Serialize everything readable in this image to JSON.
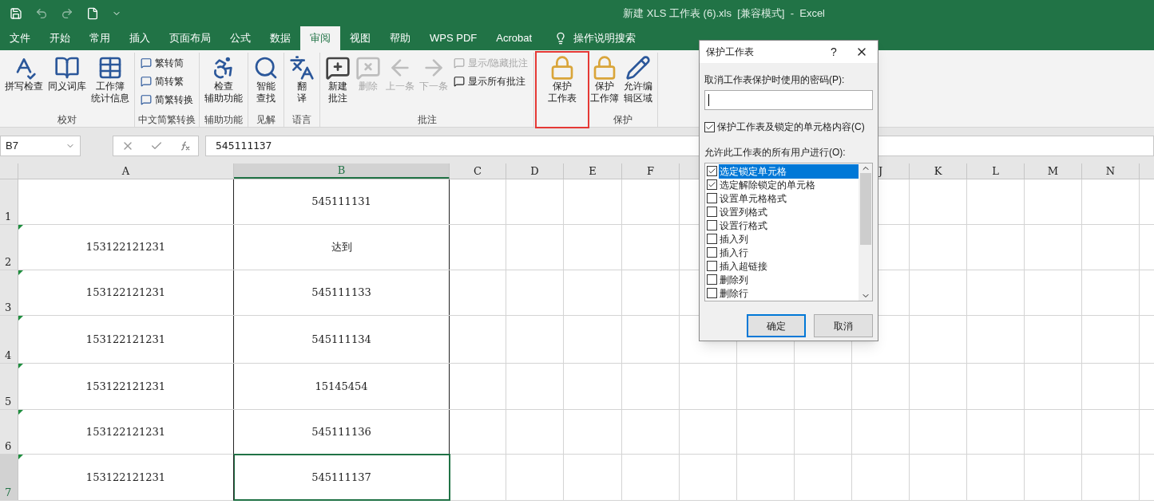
{
  "title_bar": {
    "title": "新建 XLS 工作表 (6).xls  [兼容模式]  -  Excel"
  },
  "tabs": [
    {
      "label": "文件",
      "selected": false
    },
    {
      "label": "开始",
      "selected": false
    },
    {
      "label": "常用",
      "selected": false
    },
    {
      "label": "插入",
      "selected": false
    },
    {
      "label": "页面布局",
      "selected": false
    },
    {
      "label": "公式",
      "selected": false
    },
    {
      "label": "数据",
      "selected": false
    },
    {
      "label": "审阅",
      "selected": true
    },
    {
      "label": "视图",
      "selected": false
    },
    {
      "label": "帮助",
      "selected": false
    },
    {
      "label": "WPS PDF",
      "selected": false
    },
    {
      "label": "Acrobat",
      "selected": false
    }
  ],
  "tell_me": "操作说明搜索",
  "ribbon_groups": [
    {
      "label": "校对",
      "buttons": [
        {
          "kind": "large",
          "lines": [
            "拼写检查"
          ],
          "disabled": false
        },
        {
          "kind": "large",
          "lines": [
            "同义词库"
          ],
          "disabled": false
        },
        {
          "kind": "large",
          "lines": [
            "工作簿",
            "统计信息"
          ],
          "disabled": false
        }
      ]
    },
    {
      "label": "中文简繁转换",
      "buttons": [
        {
          "kind": "small",
          "lines": [
            "繁转简"
          ],
          "disabled": false
        },
        {
          "kind": "small",
          "lines": [
            "简转繁"
          ],
          "disabled": false
        },
        {
          "kind": "small",
          "lines": [
            "简繁转换"
          ],
          "disabled": false
        }
      ]
    },
    {
      "label": "辅助功能",
      "buttons": [
        {
          "kind": "large",
          "lines": [
            "检查",
            "辅助功能"
          ],
          "disabled": false
        }
      ]
    },
    {
      "label": "见解",
      "buttons": [
        {
          "kind": "large",
          "lines": [
            "智能",
            "查找"
          ],
          "disabled": false
        }
      ]
    },
    {
      "label": "语言",
      "buttons": [
        {
          "kind": "large",
          "lines": [
            "翻",
            "译"
          ],
          "disabled": false
        }
      ]
    },
    {
      "label": "批注",
      "buttons": [
        {
          "kind": "large",
          "lines": [
            "新建",
            "批注"
          ],
          "disabled": false
        },
        {
          "kind": "large",
          "lines": [
            "删除"
          ],
          "disabled": true
        },
        {
          "kind": "large",
          "lines": [
            "上一条"
          ],
          "disabled": true
        },
        {
          "kind": "large",
          "lines": [
            "下一条"
          ],
          "disabled": true
        },
        {
          "kind": "small",
          "lines": [
            "显示/隐藏批注"
          ],
          "disabled": true
        },
        {
          "kind": "small",
          "lines": [
            "显示所有批注"
          ],
          "disabled": false
        }
      ]
    },
    {
      "label": "保护",
      "buttons": [
        {
          "kind": "large",
          "lines": [
            "保护",
            "工作表"
          ],
          "disabled": false,
          "highlighted": true
        },
        {
          "kind": "large",
          "lines": [
            "保护",
            "工作簿"
          ],
          "disabled": false,
          "highlighted": false
        },
        {
          "kind": "large",
          "lines": [
            "允许编",
            "辑区域"
          ],
          "disabled": false,
          "highlighted": false
        }
      ]
    }
  ],
  "name_box": "B7",
  "formula": "545111137",
  "columns": [
    {
      "label": "A",
      "selected": false
    },
    {
      "label": "B",
      "selected": true
    },
    {
      "label": "C",
      "selected": false
    },
    {
      "label": "D",
      "selected": false
    },
    {
      "label": "E",
      "selected": false
    },
    {
      "label": "F",
      "selected": false
    },
    {
      "label": "J",
      "selected": false
    },
    {
      "label": "K",
      "selected": false
    },
    {
      "label": "L",
      "selected": false
    },
    {
      "label": "M",
      "selected": false
    },
    {
      "label": "N",
      "selected": false
    }
  ],
  "rows": [
    {
      "number": "1",
      "a": "",
      "b": "545111131",
      "flag": false,
      "selected": false
    },
    {
      "number": "2",
      "a": "153122121231",
      "b": "达到",
      "flag": true,
      "selected": false
    },
    {
      "number": "3",
      "a": "153122121231",
      "b": "545111133",
      "flag": true,
      "selected": false
    },
    {
      "number": "4",
      "a": "153122121231",
      "b": "545111134",
      "flag": true,
      "selected": false
    },
    {
      "number": "5",
      "a": "153122121231",
      "b": "15145454",
      "flag": true,
      "selected": false
    },
    {
      "number": "6",
      "a": "153122121231",
      "b": "545111136",
      "flag": true,
      "selected": false
    },
    {
      "number": "7",
      "a": "153122121231",
      "b": "545111137",
      "flag": true,
      "selected": true
    }
  ],
  "dialog": {
    "title": "保护工作表",
    "help": "?",
    "password_label": "取消工作表保护时使用的密码(P):",
    "protect_checkbox": {
      "label": "保护工作表及锁定的单元格内容(C)",
      "checked": true
    },
    "allow_label": "允许此工作表的所有用户进行(O):",
    "permissions": [
      {
        "label": "选定锁定单元格",
        "checked": true,
        "selected": true
      },
      {
        "label": "选定解除锁定的单元格",
        "checked": true,
        "selected": false
      },
      {
        "label": "设置单元格格式",
        "checked": false,
        "selected": false
      },
      {
        "label": "设置列格式",
        "checked": false,
        "selected": false
      },
      {
        "label": "设置行格式",
        "checked": false,
        "selected": false
      },
      {
        "label": "插入列",
        "checked": false,
        "selected": false
      },
      {
        "label": "插入行",
        "checked": false,
        "selected": false
      },
      {
        "label": "插入超链接",
        "checked": false,
        "selected": false
      },
      {
        "label": "删除列",
        "checked": false,
        "selected": false
      },
      {
        "label": "删除行",
        "checked": false,
        "selected": false
      }
    ],
    "ok": "确定",
    "cancel": "取消"
  }
}
